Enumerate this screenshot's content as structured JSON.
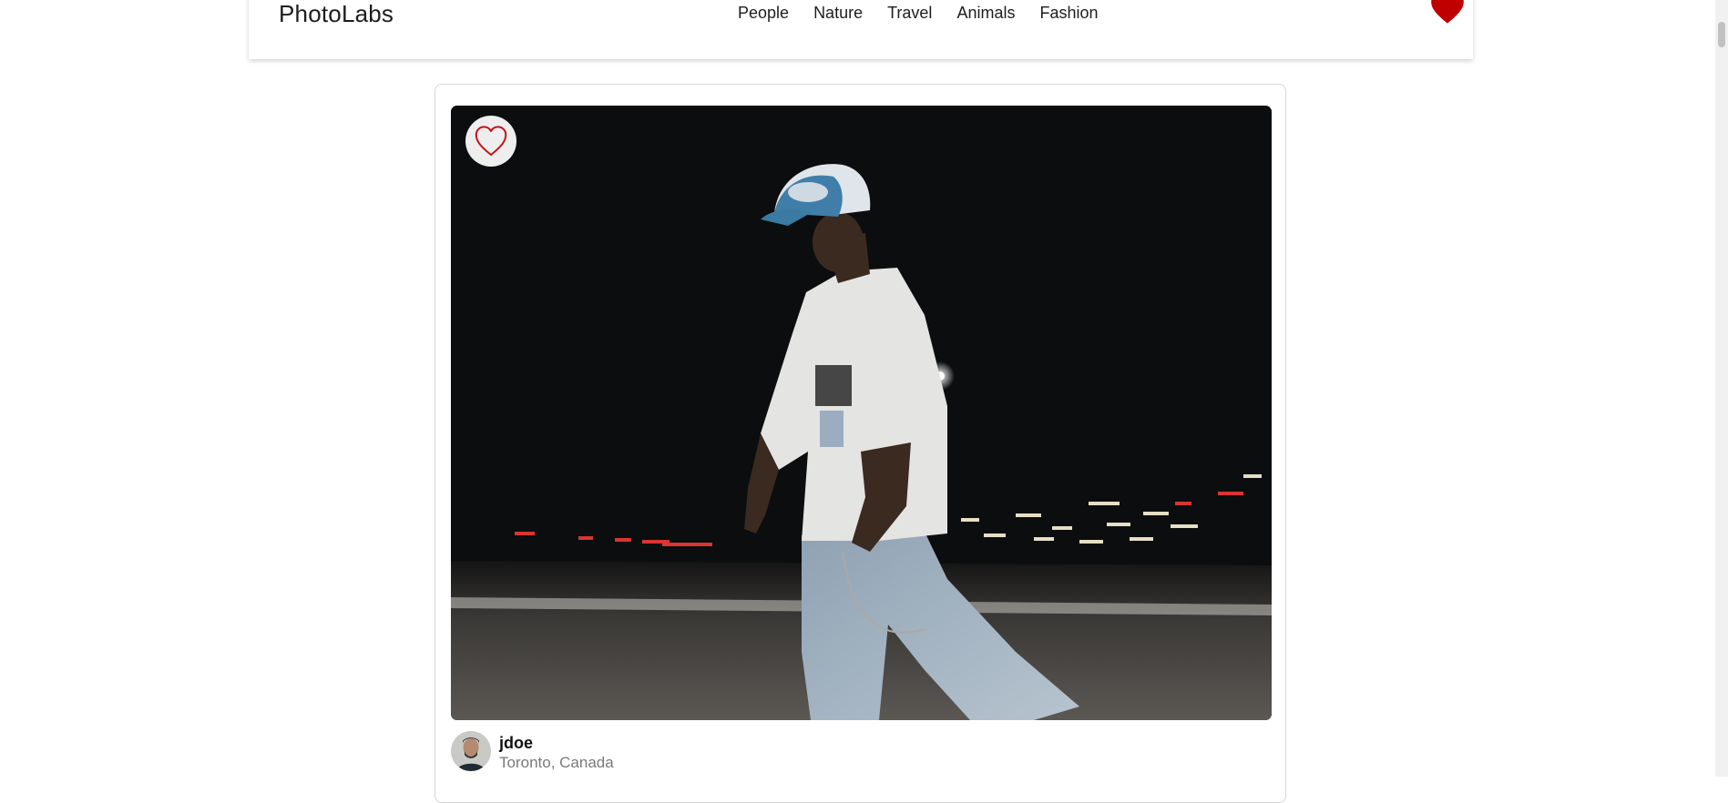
{
  "nav": {
    "logo": "PhotoLabs",
    "topics": [
      "People",
      "Nature",
      "Travel",
      "Animals",
      "Fashion"
    ],
    "fav_badge_icon": "heart-filled-icon",
    "fav_badge_color": "#c00000"
  },
  "photo": {
    "fav_icon": "heart-outline-icon",
    "fav_icon_color": "#c0141a",
    "user": {
      "username": "jdoe",
      "location": "Toronto, Canada"
    }
  }
}
